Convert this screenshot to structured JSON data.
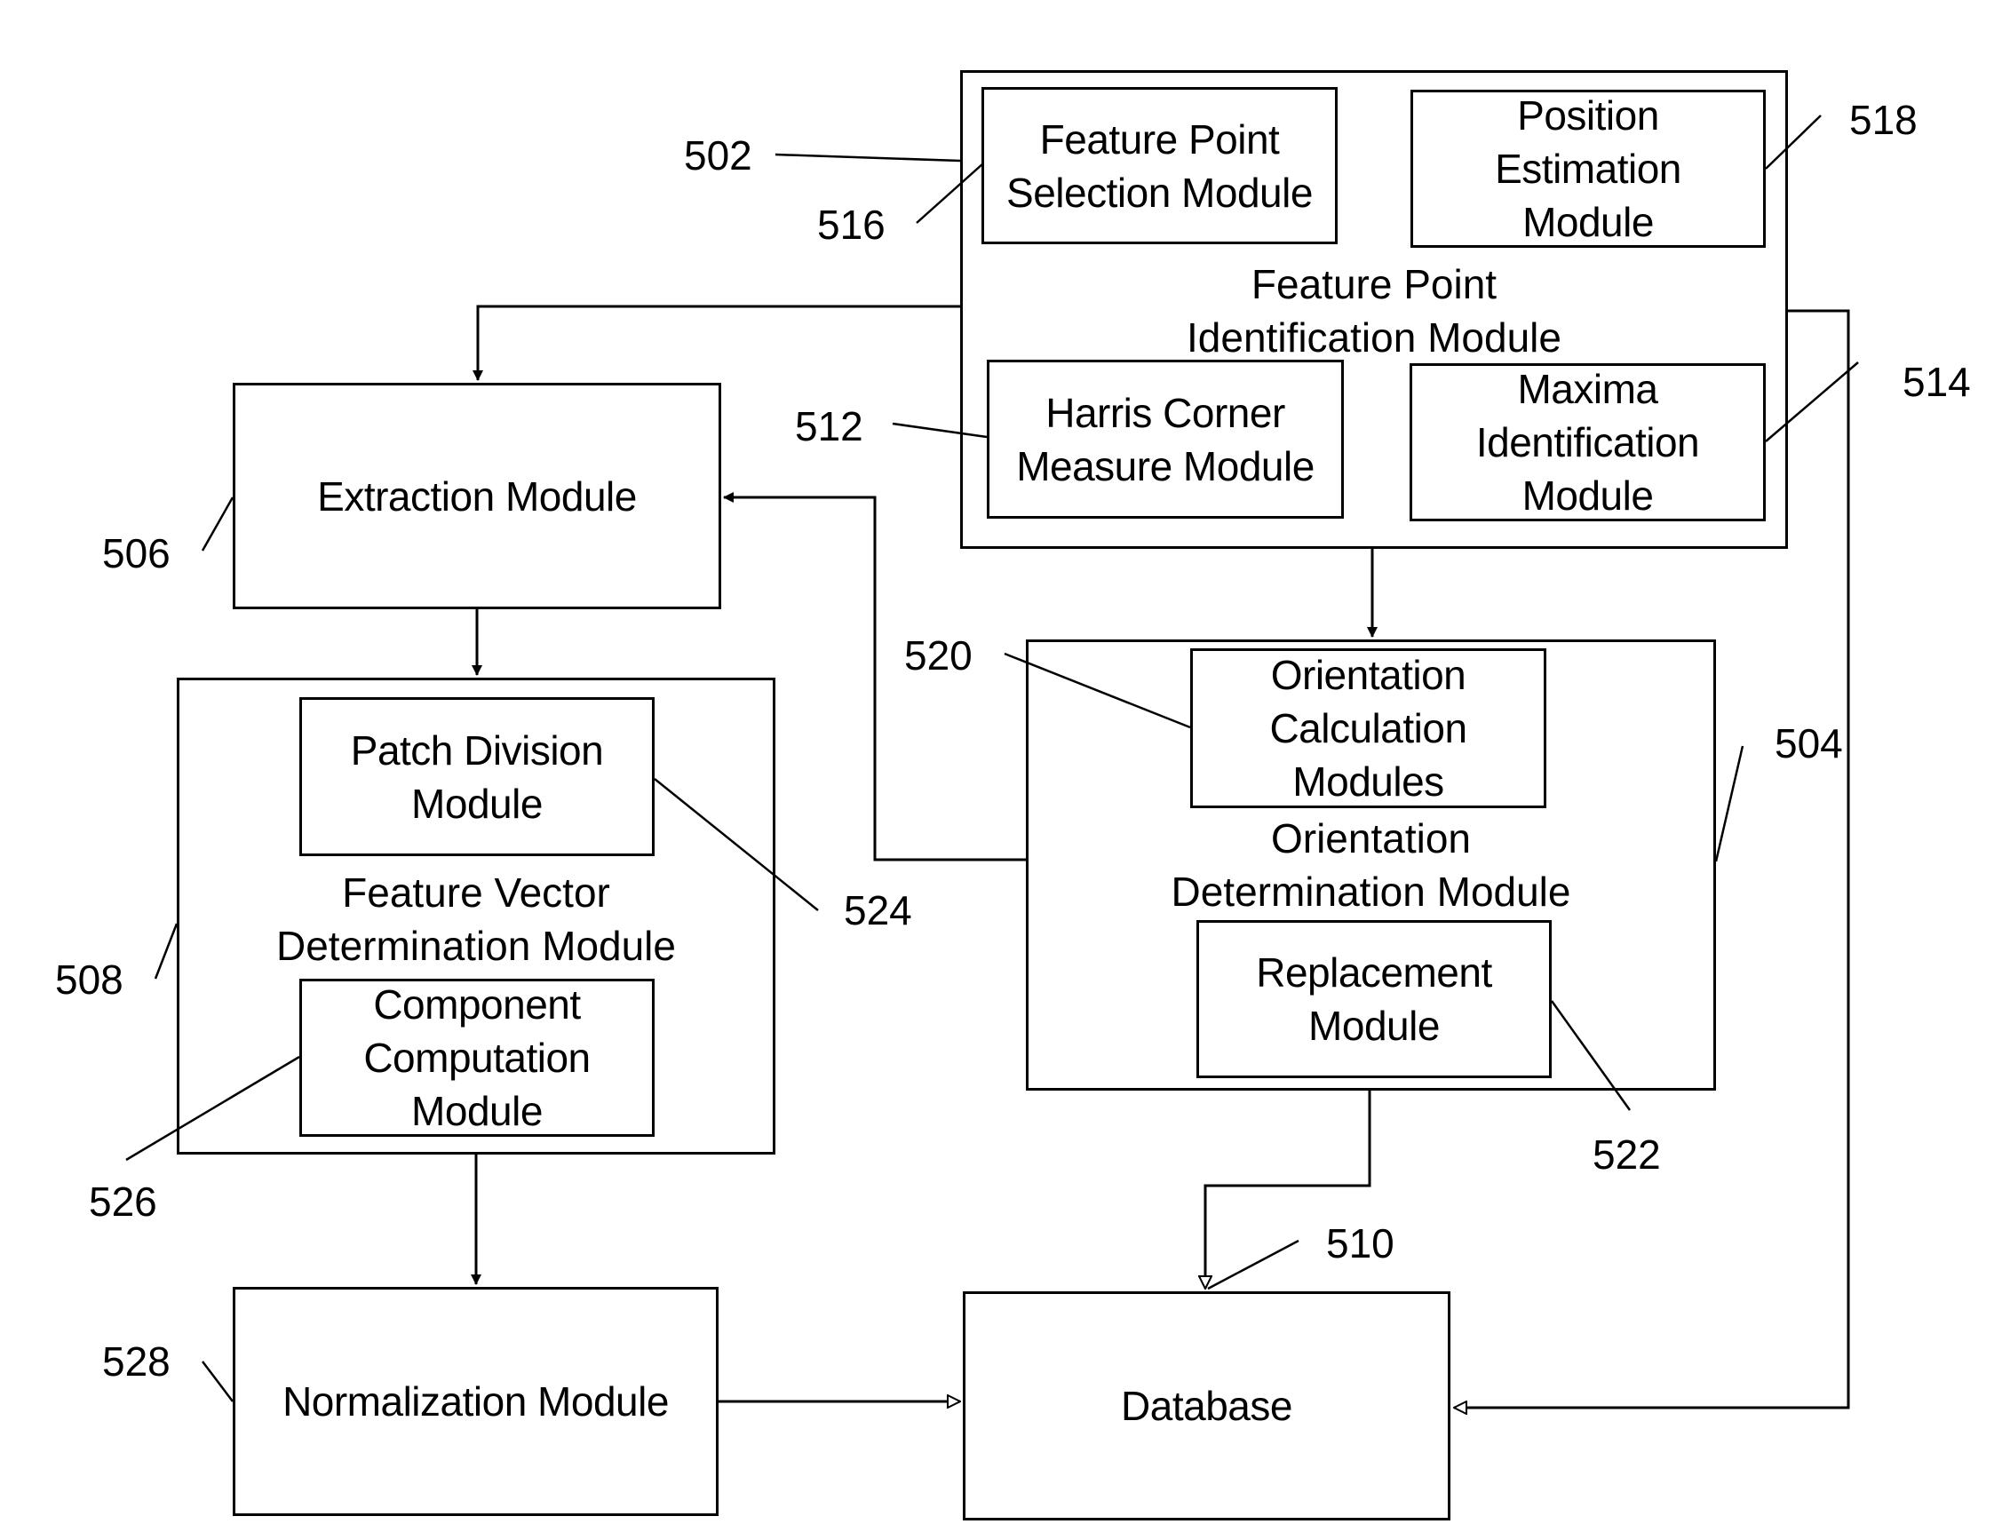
{
  "modules": {
    "feature_point_identification": {
      "ref": "502",
      "label": "Feature Point\nIdentification Module"
    },
    "feature_point_selection": {
      "ref": "516",
      "label": "Feature Point\nSelection Module"
    },
    "position_estimation": {
      "ref": "518",
      "label": "Position\nEstimation\nModule"
    },
    "harris_corner": {
      "ref": "512",
      "label": "Harris Corner\nMeasure Module"
    },
    "maxima_identification": {
      "ref": "514",
      "label": "Maxima\nIdentification\nModule"
    },
    "extraction": {
      "ref": "506",
      "label": "Extraction Module"
    },
    "feature_vector_determination": {
      "ref": "508",
      "label": "Feature Vector\nDetermination Module"
    },
    "patch_division": {
      "ref": "524",
      "label": "Patch Division\nModule"
    },
    "component_computation": {
      "ref": "526",
      "label": "Component\nComputation\nModule"
    },
    "orientation_determination": {
      "ref": "504",
      "label": "Orientation\nDetermination Module"
    },
    "orientation_calculation": {
      "ref": "520",
      "label": "Orientation\nCalculation\nModules"
    },
    "replacement": {
      "ref": "522",
      "label": "Replacement\nModule"
    },
    "normalization": {
      "ref": "528",
      "label": "Normalization Module"
    },
    "database": {
      "ref": "510",
      "label": "Database"
    }
  },
  "connections": [
    {
      "from": "feature_point_identification",
      "to": "extraction",
      "arrow": "filled"
    },
    {
      "from": "feature_point_identification",
      "to": "orientation_determination",
      "arrow": "filled"
    },
    {
      "from": "feature_point_identification",
      "to": "database",
      "arrow": "open"
    },
    {
      "from": "orientation_determination",
      "to": "extraction",
      "arrow": "filled"
    },
    {
      "from": "orientation_determination",
      "to": "database",
      "arrow": "open"
    },
    {
      "from": "extraction",
      "to": "feature_vector_determination",
      "arrow": "filled"
    },
    {
      "from": "feature_vector_determination",
      "to": "normalization",
      "arrow": "filled"
    },
    {
      "from": "normalization",
      "to": "database",
      "arrow": "open"
    }
  ]
}
